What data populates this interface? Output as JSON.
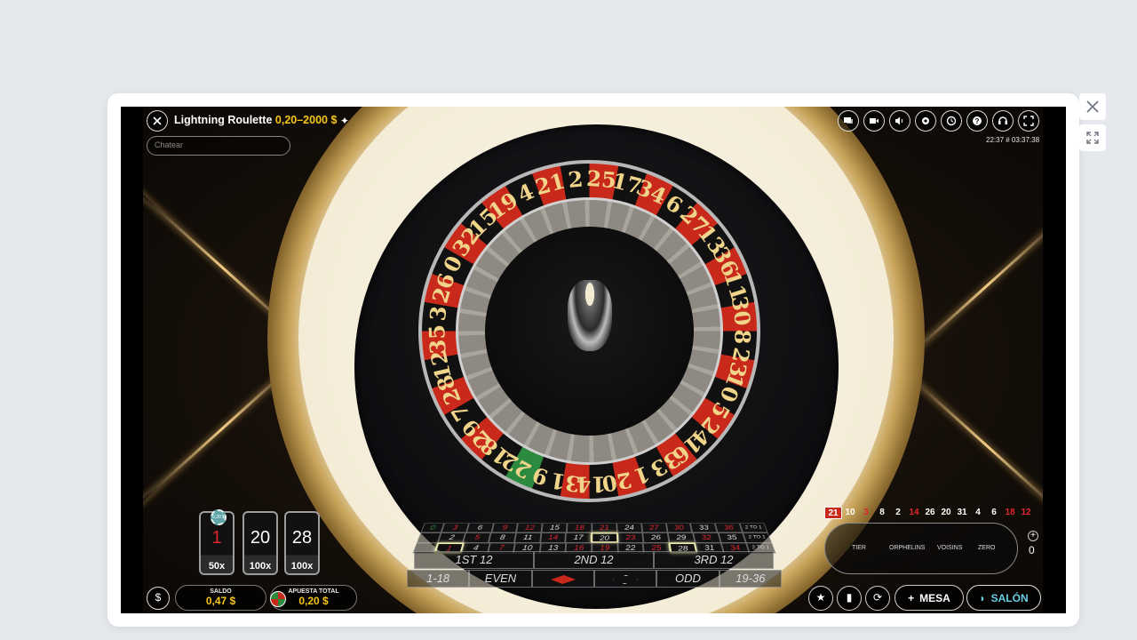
{
  "window": {
    "close_icon": "close-icon",
    "expand_icon": "expand-icon"
  },
  "game": {
    "title": "Lightning Roulette",
    "limits": "0,20–2000 $",
    "chat_placeholder": "Chatear",
    "clock": "22:37 # 03:37:38",
    "top_icons": [
      "chat-icon",
      "camera-icon",
      "volume-icon",
      "settings-icon",
      "history-icon",
      "help-icon",
      "headset-icon",
      "fullscreen-icon"
    ]
  },
  "lucky_numbers": [
    {
      "number": "1",
      "multiplier": "50x",
      "color": "#e0262f",
      "chip": "0,20 $"
    },
    {
      "number": "20",
      "multiplier": "100x",
      "color": "#ffffff"
    },
    {
      "number": "28",
      "multiplier": "100x",
      "color": "#ffffff"
    }
  ],
  "betting_table": {
    "zero": "0",
    "rows": [
      [
        "3",
        "6",
        "9",
        "12",
        "15",
        "18",
        "21",
        "24",
        "27",
        "30",
        "33",
        "36",
        "2 TO 1"
      ],
      [
        "2",
        "5",
        "8",
        "11",
        "14",
        "17",
        "20",
        "23",
        "26",
        "29",
        "32",
        "35",
        "2 TO 1"
      ],
      [
        "1",
        "4",
        "7",
        "10",
        "13",
        "16",
        "19",
        "22",
        "25",
        "28",
        "31",
        "34",
        "2 TO 1"
      ]
    ],
    "red_numbers": [
      "3",
      "9",
      "12",
      "18",
      "21",
      "27",
      "30",
      "36",
      "5",
      "14",
      "23",
      "32",
      "1",
      "7",
      "16",
      "19",
      "25",
      "34"
    ],
    "highlighted": [
      "1",
      "20",
      "28"
    ],
    "dozens": [
      "1ST 12",
      "2ND 12",
      "3RD 12"
    ],
    "outside": [
      "1-18",
      "EVEN",
      "",
      "",
      "ODD",
      "19-36"
    ],
    "chip_on_table": "0,20 $"
  },
  "history": [
    "21",
    "10",
    "3",
    "8",
    "2",
    "14",
    "26",
    "20",
    "31",
    "4",
    "6",
    "18",
    "12"
  ],
  "history_red": [
    "21",
    "3",
    "14",
    "18",
    "12"
  ],
  "racetrack": {
    "labels": [
      "TIER",
      "ORPHELINS",
      "VOISINS",
      "ZERO"
    ],
    "neighbours": "0"
  },
  "footer": {
    "balance_label": "SALDO",
    "balance_value": "0,47 $",
    "total_bet_label": "APUESTA TOTAL",
    "total_bet_value": "0,20 $",
    "mesa_label": "MESA",
    "salon_label": "SALÓN"
  },
  "colors": {
    "accent_yellow": "#f5c518",
    "red": "#c8291b",
    "salon_blue": "#6ad0e8"
  }
}
